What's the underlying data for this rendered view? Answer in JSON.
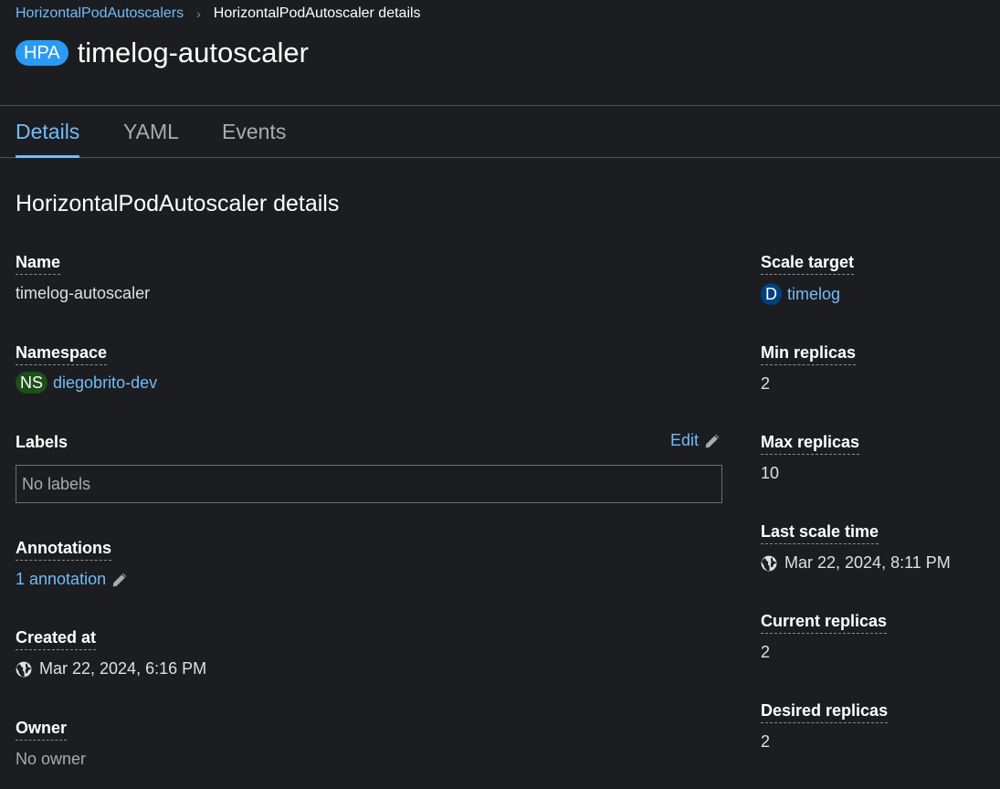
{
  "breadcrumb": {
    "parent": "HorizontalPodAutoscalers",
    "separator": "›",
    "current": "HorizontalPodAutoscaler details"
  },
  "header": {
    "badge": "HPA",
    "title": "timelog-autoscaler"
  },
  "tabs": [
    {
      "label": "Details",
      "active": true
    },
    {
      "label": "YAML"
    },
    {
      "label": "Events"
    }
  ],
  "section": {
    "title": "HorizontalPodAutoscaler details"
  },
  "left": {
    "name": {
      "label": "Name",
      "value": "timelog-autoscaler"
    },
    "namespace": {
      "label": "Namespace",
      "badge": "NS",
      "value": "diegobrito-dev"
    },
    "labels": {
      "label": "Labels",
      "edit": "Edit",
      "empty": "No labels"
    },
    "annotations": {
      "label": "Annotations",
      "value": "1 annotation"
    },
    "created": {
      "label": "Created at",
      "value": "Mar 22, 2024, 6:16 PM"
    },
    "owner": {
      "label": "Owner",
      "value": "No owner"
    }
  },
  "right": {
    "scale_target": {
      "label": "Scale target",
      "badge": "D",
      "value": "timelog"
    },
    "min_replicas": {
      "label": "Min replicas",
      "value": "2"
    },
    "max_replicas": {
      "label": "Max replicas",
      "value": "10"
    },
    "last_scale": {
      "label": "Last scale time",
      "value": "Mar 22, 2024, 8:11 PM"
    },
    "current_replicas": {
      "label": "Current replicas",
      "value": "2"
    },
    "desired_replicas": {
      "label": "Desired replicas",
      "value": "2"
    }
  },
  "colors": {
    "background": "#1b1d21",
    "link": "#73bcf7",
    "hpa_badge": "#2b9af3",
    "ns_badge": "#1e4f18",
    "d_badge": "#004080"
  },
  "icons": [
    "chevron-right-icon",
    "pencil-icon",
    "globe-icon"
  ]
}
